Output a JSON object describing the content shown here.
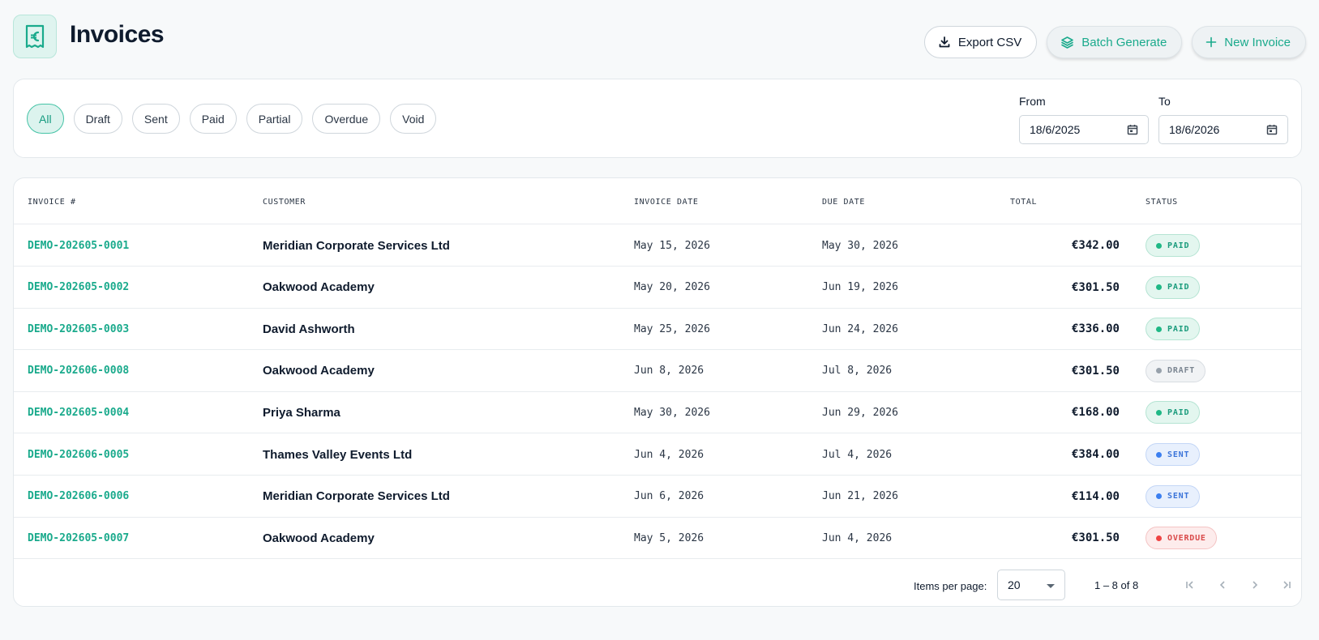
{
  "header": {
    "title": "Invoices",
    "logo_icon": "euro-receipt-icon",
    "actions": {
      "export_label": "Export CSV",
      "batch_label": "Batch Generate",
      "new_label": "New Invoice"
    }
  },
  "filters": {
    "statuses": [
      "All",
      "Draft",
      "Sent",
      "Paid",
      "Partial",
      "Overdue",
      "Void"
    ],
    "active_status": "All",
    "from_label": "From",
    "from_value": "18/6/2025",
    "to_label": "To",
    "to_value": "18/6/2026"
  },
  "table": {
    "columns": {
      "invoice": "Invoice #",
      "customer": "Customer",
      "invoice_date": "Invoice Date",
      "due_date": "Due Date",
      "total": "Total",
      "status": "Status"
    },
    "rows": [
      {
        "invoice": "DEMO-202605-0001",
        "customer": "Meridian Corporate Services Ltd",
        "invoice_date": "May 15, 2026",
        "due_date": "May 30, 2026",
        "total": "€342.00",
        "status": "PAID"
      },
      {
        "invoice": "DEMO-202605-0002",
        "customer": "Oakwood Academy",
        "invoice_date": "May 20, 2026",
        "due_date": "Jun 19, 2026",
        "total": "€301.50",
        "status": "PAID"
      },
      {
        "invoice": "DEMO-202605-0003",
        "customer": "David Ashworth",
        "invoice_date": "May 25, 2026",
        "due_date": "Jun 24, 2026",
        "total": "€336.00",
        "status": "PAID"
      },
      {
        "invoice": "DEMO-202606-0008",
        "customer": "Oakwood Academy",
        "invoice_date": "Jun 8, 2026",
        "due_date": "Jul 8, 2026",
        "total": "€301.50",
        "status": "DRAFT"
      },
      {
        "invoice": "DEMO-202605-0004",
        "customer": "Priya Sharma",
        "invoice_date": "May 30, 2026",
        "due_date": "Jun 29, 2026",
        "total": "€168.00",
        "status": "PAID"
      },
      {
        "invoice": "DEMO-202606-0005",
        "customer": "Thames Valley Events Ltd",
        "invoice_date": "Jun 4, 2026",
        "due_date": "Jul 4, 2026",
        "total": "€384.00",
        "status": "SENT"
      },
      {
        "invoice": "DEMO-202606-0006",
        "customer": "Meridian Corporate Services Ltd",
        "invoice_date": "Jun 6, 2026",
        "due_date": "Jun 21, 2026",
        "total": "€114.00",
        "status": "SENT"
      },
      {
        "invoice": "DEMO-202605-0007",
        "customer": "Oakwood Academy",
        "invoice_date": "May 5, 2026",
        "due_date": "Jun 4, 2026",
        "total": "€301.50",
        "status": "OVERDUE"
      }
    ]
  },
  "status_colors": {
    "PAID": {
      "bg": "#e3f6ef",
      "border": "#b5e4d3",
      "text": "#1a9b7c",
      "dot": "#1fb885"
    },
    "DRAFT": {
      "bg": "#f1f3f5",
      "border": "#d8dde2",
      "text": "#7a8591",
      "dot": "#97a1ab"
    },
    "SENT": {
      "bg": "#e8f0fd",
      "border": "#c3d6f6",
      "text": "#3b74d9",
      "dot": "#3b7ff0"
    },
    "OVERDUE": {
      "bg": "#fdecec",
      "border": "#f4c4c4",
      "text": "#d94a4a",
      "dot": "#ef4444"
    }
  },
  "paginator": {
    "items_per_page_label": "Items per page:",
    "items_per_page_value": "20",
    "range_label": "1 – 8 of 8"
  },
  "colors": {
    "accent": "#1aaa8c",
    "background": "#f7f9fa"
  }
}
